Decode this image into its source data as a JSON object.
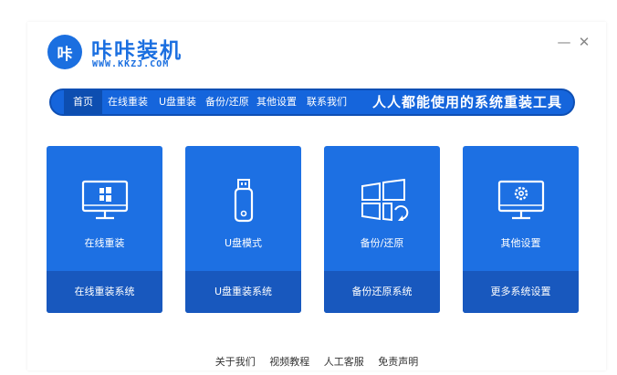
{
  "app": {
    "logo_text": "咔",
    "title": "咔咔装机",
    "url": "WWW.KKZJ.COM",
    "minimize_label": "—",
    "close_label": "✕"
  },
  "nav": {
    "items": [
      "首页",
      "在线重装",
      "U盘重装",
      "备份/还原",
      "其他设置",
      "联系我们"
    ],
    "slogan": "人人都能使用的系统重装工具"
  },
  "cards": [
    {
      "title": "在线重装",
      "footer": "在线重装系统",
      "icon": "monitor-windows-icon"
    },
    {
      "title": "U盘模式",
      "footer": "U盘重装系统",
      "icon": "usb-drive-icon"
    },
    {
      "title": "备份/还原",
      "footer": "备份还原系统",
      "icon": "windows-restore-icon"
    },
    {
      "title": "其他设置",
      "footer": "更多系统设置",
      "icon": "monitor-gear-icon"
    }
  ],
  "footer": {
    "links": [
      "关于我们",
      "视频教程",
      "人工客服",
      "免责声明"
    ]
  },
  "colors": {
    "accent": "#1b6fe0",
    "card": "#1d70e3",
    "card_footer": "#1858be",
    "nav": "#1565dc"
  }
}
